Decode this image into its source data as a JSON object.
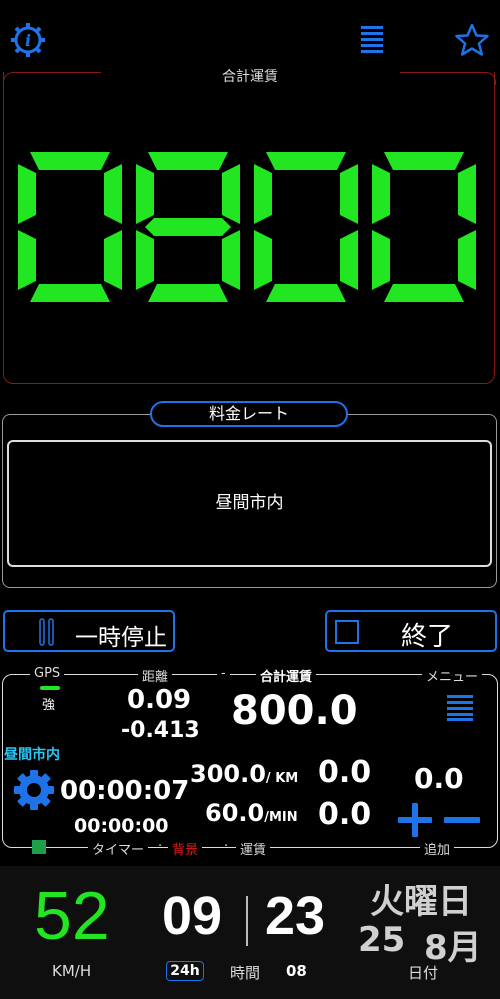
{
  "header": {
    "info_icon": "gear-info-icon",
    "menu_icon": "hamburger-icon",
    "favorite_icon": "star-icon"
  },
  "fare": {
    "title": "合計運賃",
    "display": "0800",
    "color": "#22E622"
  },
  "rate": {
    "label": "料金レート",
    "value": "昼間市内"
  },
  "controls": {
    "pause_label": "一時停止",
    "end_label": "終了"
  },
  "panel": {
    "gps_label": "GPS",
    "gps_strength": "強",
    "distance_label": "距離",
    "distance_value": "0.09",
    "distance_delta": "-0.413",
    "dash": "-",
    "total_fare_label": "合計運賃",
    "total_fare_value": "800.0",
    "menu_label": "メニュー",
    "rate_name": "昼間市内",
    "timer_main": "00:00:07",
    "timer_sub": "00:00:00",
    "rate_per_km": "300.0",
    "rate_per_km_unit": "/ KM",
    "rate_per_min": "60.0",
    "rate_per_min_unit": "/MIN",
    "km_fare": "0.0",
    "min_fare": "0.0",
    "extra_value": "0.0",
    "timer_label": "タイマー",
    "background_label": "背景",
    "fare_label": "運賃",
    "add_label": "追加",
    "bullet": "·"
  },
  "bottom": {
    "speed": "52",
    "speed_unit": "KM/H",
    "hour": "09",
    "minute": "23",
    "format_badge": "24h",
    "time_label": "時間",
    "seconds": "08",
    "weekday": "火曜日",
    "day": "25",
    "month": "8月",
    "date_label": "日付"
  },
  "colors": {
    "accent": "#1E73E8",
    "green": "#22E622",
    "cyan": "#27C8F5",
    "red": "#E11B1B"
  }
}
